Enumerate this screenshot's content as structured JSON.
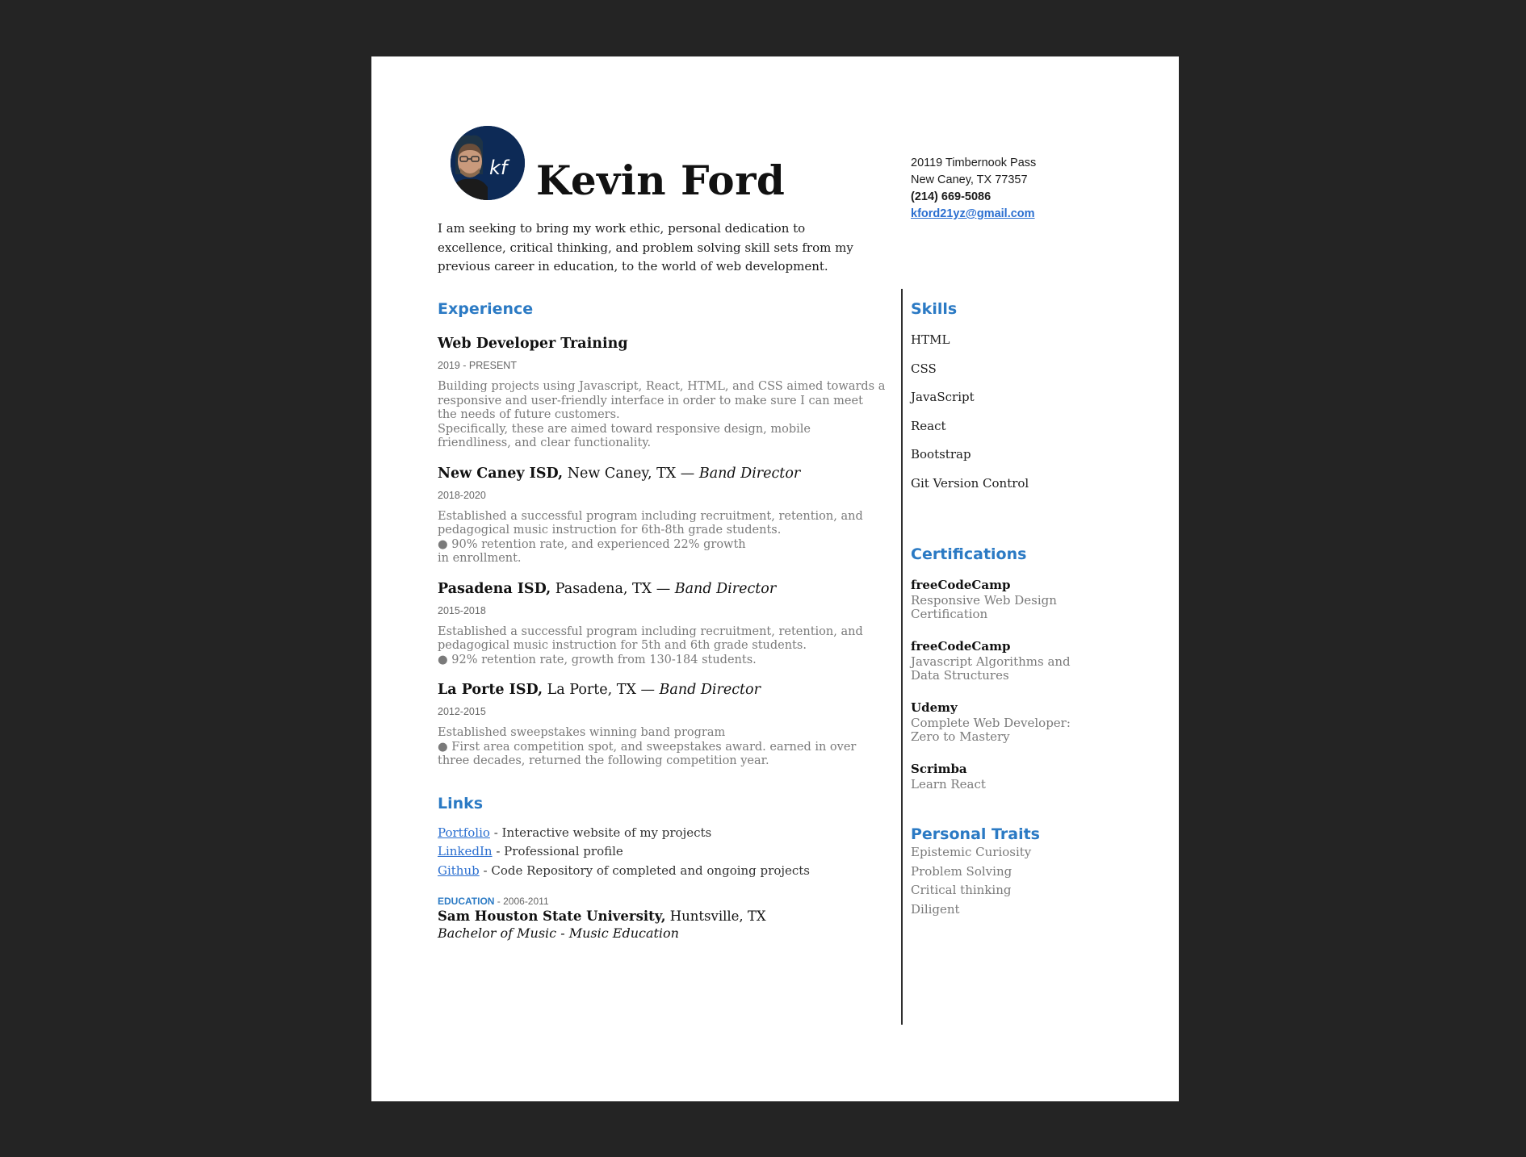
{
  "header": {
    "monogram": "kf",
    "name": "Kevin Ford",
    "summary": "I am seeking to bring my work ethic, personal dedication to excellence, critical thinking, and problem solving skill sets from my previous career in education, to the world of web development."
  },
  "contact": {
    "street": "20119 Timbernook Pass",
    "city": "New Caney, TX 77357",
    "phone": "(214) 669-5086",
    "email": "kford21yz@gmail.com"
  },
  "experience": {
    "title": "Experience",
    "items": [
      {
        "org": "Web Developer Training",
        "rest": "",
        "role": "",
        "date": "2019 - PRESENT",
        "lines": [
          "Building projects using Javascript, React, HTML, and CSS aimed towards a",
          "responsive and user-friendly interface in order to make sure I can meet",
          "the needs of future customers.",
          "Specifically, these are aimed toward responsive design, mobile",
          "friendliness, and clear functionality."
        ]
      },
      {
        "org": "New Caney ISD,",
        "rest": " New Caney, TX — ",
        "role": "Band Director",
        "date": "2018-2020",
        "lines": [
          "Established a successful program including recruitment, retention, and",
          "pedagogical music instruction for 6th-8th grade students.",
          "● 90% retention rate, and experienced 22% growth",
          "in enrollment."
        ]
      },
      {
        "org": "Pasadena ISD,",
        "rest": " Pasadena, TX — ",
        "role": "Band Director",
        "date": "2015-2018",
        "lines": [
          "Established a successful program including recruitment, retention, and",
          "pedagogical music instruction for 5th and 6th grade students.",
          "● 92% retention rate, growth from 130-184 students."
        ]
      },
      {
        "org": "La Porte ISD,",
        "rest": " La Porte, TX — ",
        "role": "Band Director",
        "date": "2012-2015",
        "lines": [
          "Established sweepstakes winning band program",
          "● First area competition spot, and sweepstakes award. earned in over",
          "three decades, returned the following competition year."
        ]
      }
    ]
  },
  "links": {
    "title": "Links",
    "items": [
      {
        "label": "Portfolio",
        "desc": " - Interactive website of my projects"
      },
      {
        "label": "LinkedIn",
        "desc": " - Professional profile"
      },
      {
        "label": "Github",
        "desc": " - Code Repository of completed and ongoing projects"
      }
    ]
  },
  "education": {
    "label": "EDUCATION",
    "years": " - 2006-2011",
    "school": "Sam Houston State University,",
    "location": " Huntsville, TX",
    "degree": "Bachelor of Music - Music Education"
  },
  "skills": {
    "title": "Skills",
    "items": [
      "HTML",
      "CSS",
      "JavaScript",
      "React",
      "Bootstrap",
      "Git Version Control"
    ]
  },
  "certifications": {
    "title": "Certifications",
    "items": [
      {
        "issuer": "freeCodeCamp",
        "lines": [
          "Responsive Web Design",
          "Certification"
        ]
      },
      {
        "issuer": "freeCodeCamp",
        "lines": [
          "Javascript Algorithms and",
          "Data Structures"
        ]
      },
      {
        "issuer": "Udemy",
        "lines": [
          "Complete Web Developer:",
          "Zero to Mastery"
        ]
      },
      {
        "issuer": "Scrimba",
        "lines": [
          "Learn React"
        ]
      }
    ]
  },
  "traits": {
    "title": "Personal Traits",
    "items": [
      "Epistemic Curiosity",
      "Problem Solving",
      "Critical thinking",
      "Diligent"
    ]
  },
  "colors": {
    "accent": "#2b7ac4",
    "link": "#2b6fd0",
    "background": "#242424",
    "avatar": "#0d2a56"
  }
}
